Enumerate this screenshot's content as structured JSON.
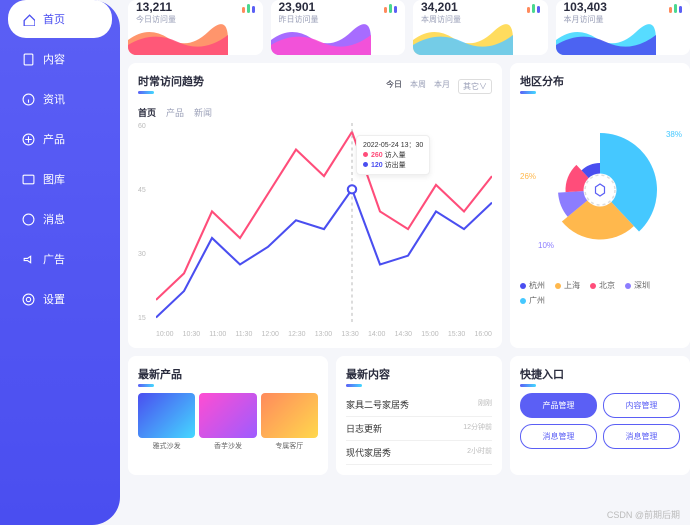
{
  "sidebar": {
    "items": [
      {
        "label": "首页",
        "icon": "home",
        "active": true
      },
      {
        "label": "内容",
        "icon": "doc"
      },
      {
        "label": "资讯",
        "icon": "info"
      },
      {
        "label": "产品",
        "icon": "cube"
      },
      {
        "label": "图库",
        "icon": "image"
      },
      {
        "label": "消息",
        "icon": "bell"
      },
      {
        "label": "广告",
        "icon": "speaker"
      },
      {
        "label": "设置",
        "icon": "gear"
      }
    ]
  },
  "stats": [
    {
      "value": "13,211",
      "label": "今日访问量",
      "colors": [
        "#ff8a5c",
        "#ff4d7a"
      ]
    },
    {
      "value": "23,901",
      "label": "昨日访问量",
      "colors": [
        "#9d5cff",
        "#ff4dd2"
      ]
    },
    {
      "value": "34,201",
      "label": "本周访问量",
      "colors": [
        "#ffd84d",
        "#5cc9ff"
      ]
    },
    {
      "value": "103,403",
      "label": "本月访问量",
      "colors": [
        "#45d8ff",
        "#4a4ef0"
      ]
    }
  ],
  "trend": {
    "title": "时常访问趋势",
    "timeTabs": [
      "今日",
      "本周",
      "本月"
    ],
    "timeActive": 0,
    "selector": "其它∨",
    "subTabs": [
      "首页",
      "产品",
      "新闻"
    ],
    "subActive": 0,
    "yTicks": [
      "60",
      "45",
      "30",
      "15"
    ],
    "xTicks": [
      "10:00",
      "10:30",
      "11:00",
      "11:30",
      "12:00",
      "12:30",
      "13:00",
      "13:30",
      "14:00",
      "14:30",
      "15:00",
      "15:30",
      "16:00"
    ],
    "tooltip": {
      "datetime": "2022-05-24 13：30",
      "series": [
        {
          "label": "访入量",
          "value": "260",
          "color": "#ff4d7a"
        },
        {
          "label": "访出量",
          "value": "120",
          "color": "#4a4ef0"
        }
      ]
    }
  },
  "chart_data": {
    "type": "line",
    "title": "时常访问趋势",
    "xlabel": "",
    "ylabel": "",
    "ylim": [
      15,
      60
    ],
    "categories": [
      "10:00",
      "10:30",
      "11:00",
      "11:30",
      "12:00",
      "12:30",
      "13:00",
      "13:30",
      "14:00",
      "14:30",
      "15:00",
      "15:30",
      "16:00"
    ],
    "series": [
      {
        "name": "访入量",
        "color": "#ff4d7a",
        "values": [
          20,
          26,
          40,
          34,
          44,
          54,
          48,
          58,
          40,
          36,
          46,
          40,
          48
        ]
      },
      {
        "name": "访出量",
        "color": "#4a4ef0",
        "values": [
          16,
          22,
          34,
          28,
          32,
          38,
          36,
          45,
          28,
          30,
          40,
          36,
          42
        ]
      }
    ]
  },
  "region": {
    "title": "地区分布",
    "labels": [
      {
        "text": "38%",
        "color": "#45c8ff",
        "pos": "r"
      },
      {
        "text": "26%",
        "color": "#ffb84d",
        "pos": "l1"
      },
      {
        "text": "10%",
        "color": "#8c7dff",
        "pos": "l2"
      }
    ],
    "legend": [
      {
        "name": "杭州",
        "color": "#4a4ef0"
      },
      {
        "name": "上海",
        "color": "#ffb84d"
      },
      {
        "name": "北京",
        "color": "#ff4d7a"
      },
      {
        "name": "深圳",
        "color": "#8c7dff"
      },
      {
        "name": "广州",
        "color": "#45c8ff"
      }
    ],
    "chart_data": {
      "type": "pie",
      "title": "地区分布",
      "series": [
        {
          "name": "广州",
          "value": 38,
          "color": "#45c8ff"
        },
        {
          "name": "上海",
          "value": 26,
          "color": "#ffb84d"
        },
        {
          "name": "深圳",
          "value": 10,
          "color": "#8c7dff"
        },
        {
          "name": "北京",
          "value": 14,
          "color": "#ff4d7a"
        },
        {
          "name": "杭州",
          "value": 12,
          "color": "#4a4ef0"
        }
      ]
    }
  },
  "products": {
    "title": "最新产品",
    "items": [
      {
        "name": "雅式沙发",
        "bg": "linear-gradient(135deg,#4a4ef0,#45d8ff)"
      },
      {
        "name": "香芋沙发",
        "bg": "linear-gradient(135deg,#ff4dd2,#9d5cff)"
      },
      {
        "name": "专属客厅",
        "bg": "linear-gradient(135deg,#ff8a5c,#ffd84d)"
      }
    ]
  },
  "content": {
    "title": "最新内容",
    "items": [
      {
        "title": "家具二号家居秀",
        "time": "刚刚"
      },
      {
        "title": "日志更新",
        "time": "12分钟前"
      },
      {
        "title": "现代家居秀",
        "time": "2小时前"
      }
    ]
  },
  "quick": {
    "title": "快捷入口",
    "buttons": [
      {
        "label": "产品管理",
        "primary": true
      },
      {
        "label": "内容管理"
      },
      {
        "label": "消息管理"
      },
      {
        "label": "消息管理"
      }
    ]
  },
  "watermark": "CSDN @前期后期"
}
